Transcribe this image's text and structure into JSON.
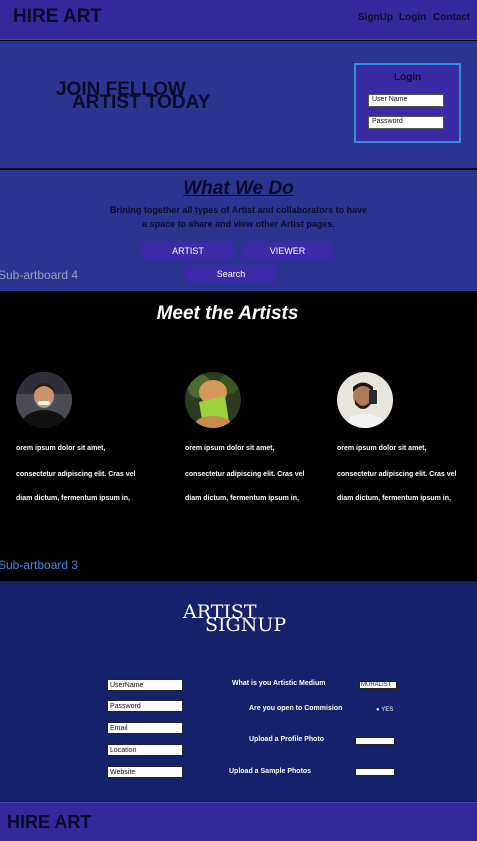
{
  "header": {
    "brand": "HIRE ART",
    "nav": [
      "SignUp",
      "Login",
      "Contact"
    ]
  },
  "hero": {
    "line1": "JOIN FELLOW",
    "line2": "ARTIST TODAY",
    "login": {
      "title": "Login",
      "username_placeholder": "User Name",
      "password_placeholder": "Password"
    }
  },
  "what_we_do": {
    "title": "What We Do",
    "text_line1": "Brining together all types of Artist and collaborators to have",
    "text_line2": "a space to share and view other Artist pages.",
    "artist_button": "ARTIST",
    "viewer_button": "VIEWER",
    "search_button": "Search",
    "artboard_label": "Sub-artboard  4"
  },
  "meet": {
    "title": "Meet the Artists",
    "artists": [
      {
        "line1": "orem ipsum dolor sit amet,",
        "line2": "consectetur adipiscing elit. Cras vel",
        "line3": "diam dictum, fermentum ipsum in,"
      },
      {
        "line1": "orem ipsum dolor sit amet,",
        "line2": "consectetur adipiscing elit. Cras vel",
        "line3": "diam dictum, fermentum ipsum in,"
      },
      {
        "line1": "orem ipsum dolor sit amet,",
        "line2": "consectetur adipiscing elit. Cras vel",
        "line3": "diam dictum, fermentum ipsum in,"
      }
    ],
    "artboard_label": "Sub-artboard  3"
  },
  "signup": {
    "title_line1": "ARTIST",
    "title_line2": "SIGNUP",
    "fields": {
      "username": "UserName",
      "password": "Password",
      "email": "Email",
      "location": "Location",
      "website": "Website"
    },
    "medium_label": "What is you Artistic Medium",
    "medium_value": "MURALIST",
    "commission_label": "Are you open to Commision",
    "commission_option": "YES",
    "profile_photo_label": "Upload a Profile Photo",
    "sample_photos_label": "Upload a Sample Photos"
  },
  "footer": {
    "brand": "HIRE ART"
  },
  "colors": {
    "header_bg": "#35289a",
    "hero_bg": "#2b3590",
    "signup_bg": "#15216a",
    "accent_button": "#3c2aa8",
    "login_border": "#2f8fd8",
    "artboard_label_gray": "#9aa0b8",
    "artboard_label_blue": "#3f8de0"
  }
}
